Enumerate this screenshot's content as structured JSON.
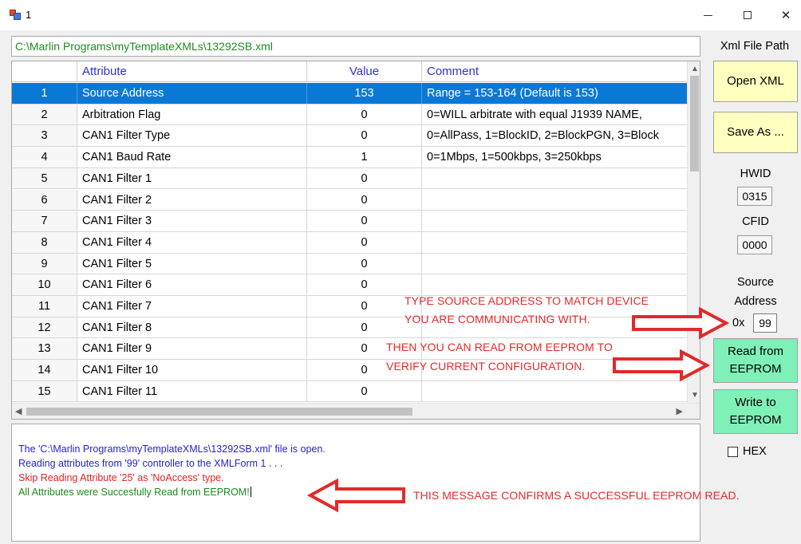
{
  "window": {
    "title": "1",
    "minimize_icon": "minimize-icon",
    "maximize_icon": "maximize-icon",
    "close_glyph": "✕"
  },
  "file_path": "C:\\Marlin Programs\\myTemplateXMLs\\13292SB.xml",
  "grid": {
    "columns": {
      "attribute": "Attribute",
      "value": "Value",
      "comment": "Comment"
    },
    "rows": [
      {
        "index": "1",
        "attribute": "Source Address",
        "value": "153",
        "comment": "Range = 153-164 (Default is 153)",
        "selected": true
      },
      {
        "index": "2",
        "attribute": "Arbitration Flag",
        "value": "0",
        "comment": "0=WILL arbitrate with equal J1939 NAME,"
      },
      {
        "index": "3",
        "attribute": "CAN1 Filter Type",
        "value": "0",
        "comment": "0=AllPass, 1=BlockID, 2=BlockPGN, 3=Block"
      },
      {
        "index": "4",
        "attribute": "CAN1 Baud Rate",
        "value": "1",
        "comment": "0=1Mbps, 1=500kbps, 3=250kbps"
      },
      {
        "index": "5",
        "attribute": "CAN1 Filter 1",
        "value": "0",
        "comment": ""
      },
      {
        "index": "6",
        "attribute": "CAN1 Filter 2",
        "value": "0",
        "comment": ""
      },
      {
        "index": "7",
        "attribute": "CAN1 Filter 3",
        "value": "0",
        "comment": ""
      },
      {
        "index": "8",
        "attribute": "CAN1 Filter 4",
        "value": "0",
        "comment": ""
      },
      {
        "index": "9",
        "attribute": "CAN1 Filter 5",
        "value": "0",
        "comment": ""
      },
      {
        "index": "10",
        "attribute": "CAN1 Filter 6",
        "value": "0",
        "comment": ""
      },
      {
        "index": "11",
        "attribute": "CAN1 Filter 7",
        "value": "0",
        "comment": ""
      },
      {
        "index": "12",
        "attribute": "CAN1 Filter 8",
        "value": "0",
        "comment": ""
      },
      {
        "index": "13",
        "attribute": "CAN1 Filter 9",
        "value": "0",
        "comment": ""
      },
      {
        "index": "14",
        "attribute": "CAN1 Filter 10",
        "value": "0",
        "comment": ""
      },
      {
        "index": "15",
        "attribute": "CAN1 Filter 11",
        "value": "0",
        "comment": ""
      }
    ]
  },
  "log": [
    {
      "text": "The 'C:\\Marlin Programs\\myTemplateXMLs\\13292SB.xml' file is open.",
      "color": "blue"
    },
    {
      "text": "Reading attributes from '99' controller to the XMLForm 1 . . .",
      "color": "blue"
    },
    {
      "text": "Skip Reading Attribute '25' as 'NoAccess' type.",
      "color": "red"
    },
    {
      "text": "All Attributes were Succesfully Read from EEPROM!",
      "color": "green"
    }
  ],
  "panel": {
    "xml_file_path_label": "Xml File Path",
    "open_xml_button": "Open XML",
    "save_as_button": "Save As ...",
    "hwid_label": "HWID",
    "hwid_value": "0315",
    "cfid_label": "CFID",
    "cfid_value": "0000",
    "source_label": "Source",
    "address_label": "Address",
    "address_prefix": "0x",
    "address_value": "99",
    "read_button_line1": "Read from",
    "read_button_line2": "EEPROM",
    "write_button_line1": "Write to",
    "write_button_line2": "EEPROM",
    "hex_label": "HEX"
  },
  "annotations": {
    "source_line1": "TYPE SOURCE ADDRESS TO MATCH DEVICE",
    "source_line2": "YOU ARE COMMUNICATING WITH.",
    "read_line1": "THEN YOU CAN READ FROM EEPROM TO",
    "read_line2": "VERIFY CURRENT CONFIGURATION.",
    "log_note": "THIS MESSAGE CONFIRMS A SUCCESSFUL EEPROM READ."
  },
  "colors": {
    "selection": "#0a78d7",
    "path_text": "#1f8a1f",
    "header_text": "#3232c8",
    "yellow_button": "#ffffc0",
    "green_button": "#7ff0b8",
    "annotation": "#ea2828"
  }
}
